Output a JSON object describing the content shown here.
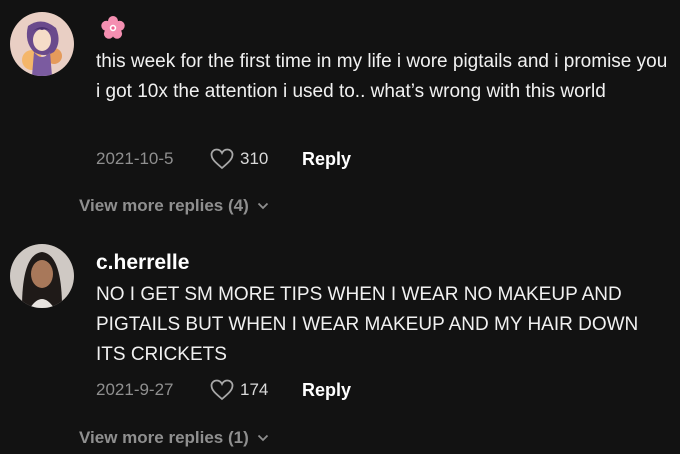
{
  "comments": [
    {
      "username": "",
      "emoji_icon": "cherry-blossom-icon",
      "text": "this week for the first time in my life i wore pigtails and i promise you i got 10x the attention i used to.. what’s wrong with this world",
      "date": "2021-10-5",
      "likes": "310",
      "reply_label": "Reply",
      "view_more": "View more replies (4)"
    },
    {
      "username": "c.herrelle",
      "text": "NO I GET SM MORE TIPS WHEN I WEAR NO MAKEUP AND PIGTAILS BUT WHEN I WEAR MAKEUP AND MY HAIR DOWN ITS CRICKETS",
      "date": "2021-9-27",
      "likes": "174",
      "reply_label": "Reply",
      "view_more": "View more replies (1)"
    }
  ],
  "colors": {
    "background": "#121212",
    "secondary_text": "#8f8f8f",
    "primary_text": "#ffffff",
    "flower": "#f06292"
  }
}
